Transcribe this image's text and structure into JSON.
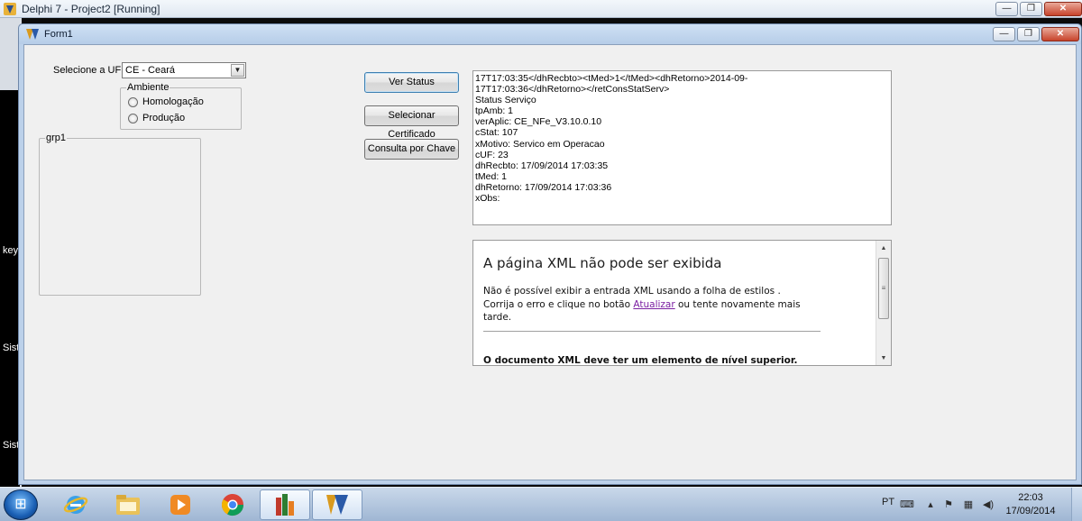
{
  "ide": {
    "title": "Delphi 7 - Project2 [Running]",
    "side_labels": [
      "key",
      "Sist",
      "Sist"
    ]
  },
  "form": {
    "title": "Form1",
    "uf_label": "Selecione a UF:",
    "uf_selected": "CE - Ceará",
    "ambiente": {
      "caption": "Ambiente",
      "options": [
        "Homologação",
        "Produção"
      ]
    },
    "group_caption": "grp1",
    "buttons": {
      "ver_status": "Ver Status",
      "selecionar_certificado": "Selecionar Certificado",
      "consulta_chave": "Consulta por Chave"
    },
    "memo_lines": [
      "17T17:03:35</dhRecbto><tMed>1</tMed><dhRetorno>2014-09-",
      "17T17:03:36</dhRetorno></retConsStatServ>",
      "Status Serviço",
      "tpAmb: 1",
      "verAplic: CE_NFe_V3.10.0.10",
      "cStat: 107",
      "xMotivo: Servico em Operacao",
      "cUF: 23",
      "dhRecbto: 17/09/2014 17:03:35",
      "tMed: 1",
      "dhRetorno: 17/09/2014 17:03:36",
      "xObs:"
    ],
    "browser": {
      "heading": "A página XML não pode ser exibida",
      "body_line1": "Não é possível exibir a entrada XML usando a folha de estilos .",
      "body_line2_pre": "Corrija o erro e clique no botão ",
      "body_link": "Atualizar",
      "body_line2_post": " ou tente novamente mais tarde.",
      "error": "O documento XML deve ter um elemento de nível superior."
    }
  },
  "taskbar": {
    "language": "PT",
    "time": "22:03",
    "date": "17/09/2014"
  },
  "icons": {
    "minimize": "—",
    "restore": "❐",
    "close": "✕",
    "combo_arrow": "▼",
    "scroll_up": "▲",
    "scroll_down": "▼",
    "scroll_grip": "≡",
    "start": "⊞"
  }
}
